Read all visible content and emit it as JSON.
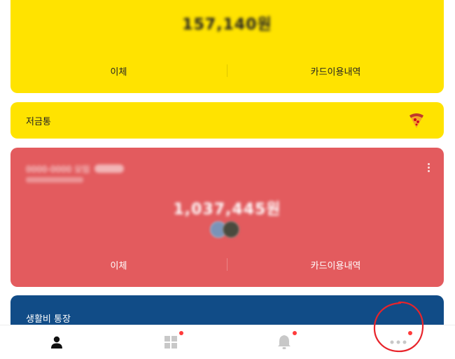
{
  "top_account": {
    "balance": "157,140원",
    "actions": {
      "transfer": "이체",
      "card_history": "카드이용내역"
    }
  },
  "piggy_bank": {
    "label": "저금통",
    "icon": "pizza-icon"
  },
  "shared_account": {
    "balance": "1,037,445원",
    "actions": {
      "transfer": "이체",
      "card_history": "카드이용내역"
    }
  },
  "living_account": {
    "label": "생활비 통장"
  },
  "bottom_nav": {
    "items": [
      {
        "icon": "person-icon",
        "active": true
      },
      {
        "icon": "grid-icon",
        "badge": true
      },
      {
        "icon": "bell-icon",
        "badge": true
      },
      {
        "icon": "more-icon",
        "badge": true
      }
    ]
  },
  "colors": {
    "yellow": "#FFE300",
    "red": "#E35B5E",
    "blue": "#114C87",
    "badge": "#FF3B3B",
    "annotation": "#E8242B"
  }
}
